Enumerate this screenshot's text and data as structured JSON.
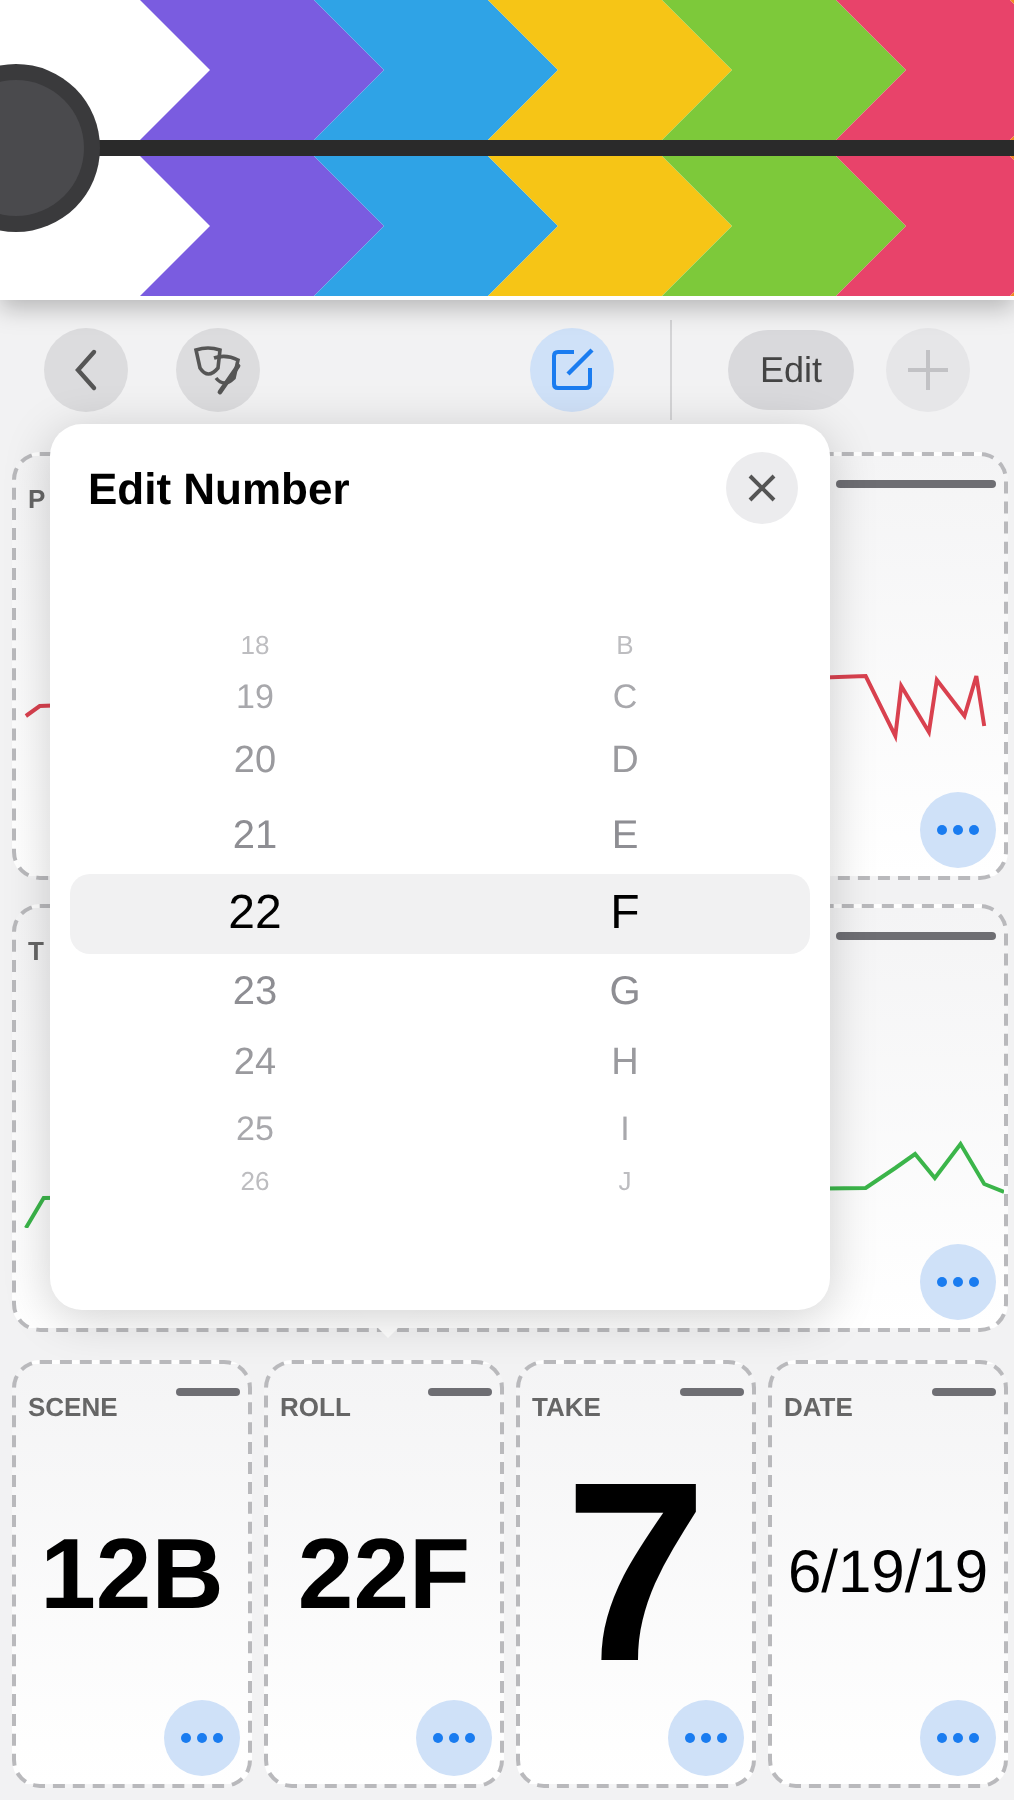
{
  "toolbar": {
    "compose_selected": true,
    "edit_label": "Edit",
    "add_disabled": true
  },
  "panels": [
    {
      "label": "P",
      "color": "#d9414f"
    },
    {
      "label": "T",
      "color": "#3bb54a"
    }
  ],
  "popover": {
    "title": "Edit Number",
    "columns": [
      {
        "items": [
          {
            "text": "18",
            "selected": false
          },
          {
            "text": "19",
            "selected": false
          },
          {
            "text": "20",
            "selected": false
          },
          {
            "text": "21",
            "selected": false
          },
          {
            "text": "22",
            "selected": true
          },
          {
            "text": "23",
            "selected": false
          },
          {
            "text": "24",
            "selected": false
          },
          {
            "text": "25",
            "selected": false
          },
          {
            "text": "26",
            "selected": false
          }
        ]
      },
      {
        "items": [
          {
            "text": "B",
            "selected": false
          },
          {
            "text": "C",
            "selected": false
          },
          {
            "text": "D",
            "selected": false
          },
          {
            "text": "E",
            "selected": false
          },
          {
            "text": "F",
            "selected": true
          },
          {
            "text": "G",
            "selected": false
          },
          {
            "text": "H",
            "selected": false
          },
          {
            "text": "I",
            "selected": false
          },
          {
            "text": "J",
            "selected": false
          }
        ]
      }
    ]
  },
  "slots": [
    {
      "label": "SCENE",
      "value": "12B",
      "kind": "code"
    },
    {
      "label": "ROLL",
      "value": "22F",
      "kind": "code"
    },
    {
      "label": "TAKE",
      "value": "7",
      "kind": "take"
    },
    {
      "label": "DATE",
      "value": "6/19/19",
      "kind": "date"
    }
  ]
}
